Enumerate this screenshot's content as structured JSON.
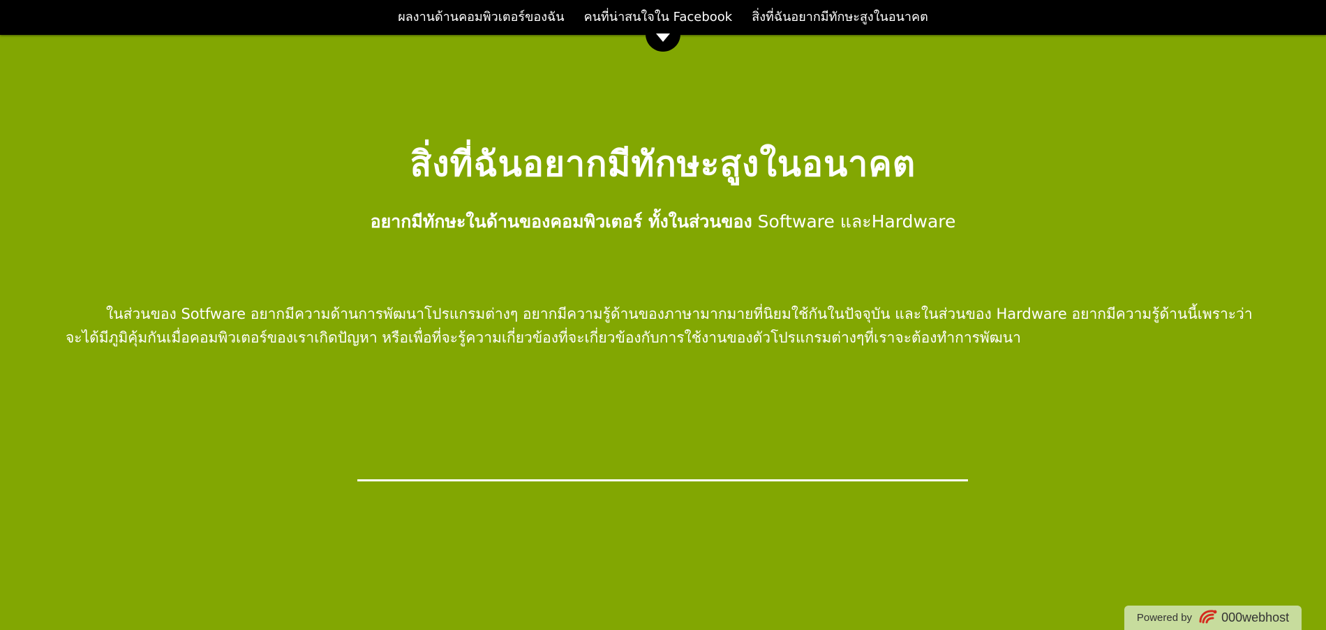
{
  "nav": {
    "items": [
      {
        "label": "ผลงานด้านคอมพิวเตอร์ของฉัน"
      },
      {
        "label": "คนที่น่าสนใจใน Facebook"
      },
      {
        "label": "สิ่งที่ฉันอยากมีทักษะสูงในอนาคต"
      }
    ]
  },
  "main": {
    "title": "สิ่งที่ฉันอยากมีทักษะสูงในอนาคต",
    "subtitle_bold": "อยากมีทักษะในด้านของคอมพิวเตอร์ ทั้งในส่วนของ",
    "subtitle_rest": " Software และHardware",
    "paragraph": "ในส่วนของ Sotfware อยากมีความด้านการพัฒนาโปรแกรมต่างๆ อยากมีความรู้ด้านของภาษามากมายที่นิยมใช้กันในปัจจุบัน และในส่วนของ Hardware อยากมีความรู้ด้านนี้เพราะว่าจะได้มีภูมิคุ้มกันเมื่อคอมพิวเตอร์ของเราเกิดปัญหา หรือเพื่อที่จะรู้ความเกี่ยวข้องที่จะเกี่ยวข้องกับการใช้งานของตัวโปรแกรมต่างๆที่เราจะต้องทำการพัฒนา"
  },
  "footer": {
    "powered_label": "Powered by",
    "brand": "000webhost"
  },
  "colors": {
    "background": "#82a702",
    "topbar": "#000000",
    "text": "#ffffff",
    "badge": "#c7dc9d"
  },
  "icons": {
    "nav_toggle": "triangle-down-icon",
    "brand_logo": "webhost-logo-icon"
  }
}
